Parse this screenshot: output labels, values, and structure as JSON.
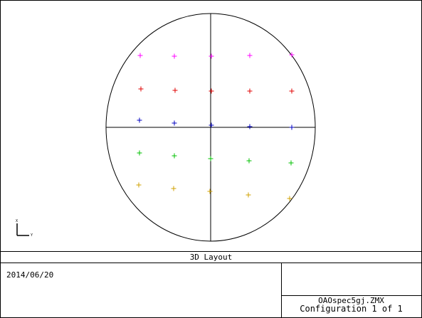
{
  "title_block": {
    "title": "3D Layout",
    "date": "2014/06/20",
    "filename": "OAOspec5gj.ZMX",
    "configuration": "Configuration 1 of 1"
  },
  "axis_triad": {
    "vertical_label": "X",
    "horizontal_label": "Y"
  },
  "field_markers": {
    "rows": [
      {
        "color": "#ff00ff",
        "count": 5
      },
      {
        "color": "#e00000",
        "count": 5
      },
      {
        "color": "#0000c0",
        "count": 5
      },
      {
        "color": "#00c000",
        "count": 5
      },
      {
        "color": "#d0a000",
        "count": 5
      }
    ]
  },
  "colors": {
    "line": "#000000",
    "background": "#ffffff"
  }
}
